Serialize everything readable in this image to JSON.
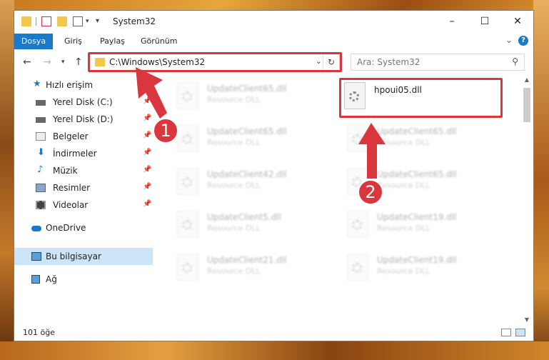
{
  "window": {
    "title": "System32"
  },
  "ribbon": {
    "tabs": [
      "Dosya",
      "Giriş",
      "Paylaş",
      "Görünüm"
    ]
  },
  "address": {
    "path": "C:\\Windows\\System32"
  },
  "search": {
    "placeholder": "Ara: System32"
  },
  "sidebar": {
    "items": [
      {
        "label": "Hızlı erişim",
        "icon": "star-icon"
      },
      {
        "label": "Yerel Disk (C:)",
        "icon": "drive-icon",
        "pinned": true
      },
      {
        "label": "Yerel Disk (D:)",
        "icon": "drive-icon",
        "pinned": true
      },
      {
        "label": "Belgeler",
        "icon": "documents-icon",
        "pinned": true
      },
      {
        "label": "İndirmeler",
        "icon": "download-icon",
        "pinned": true
      },
      {
        "label": "Müzik",
        "icon": "music-icon",
        "pinned": true
      },
      {
        "label": "Resimler",
        "icon": "pictures-icon",
        "pinned": true
      },
      {
        "label": "Videolar",
        "icon": "videos-icon",
        "pinned": true
      },
      {
        "label": "OneDrive",
        "icon": "cloud-icon"
      },
      {
        "label": "Bu bilgisayar",
        "icon": "computer-icon",
        "selected": true
      },
      {
        "label": "Ağ",
        "icon": "network-icon"
      }
    ]
  },
  "files": {
    "highlighted": {
      "name": "hpoui05.dll"
    },
    "items": [
      {
        "name": "UpdateClient65.dll",
        "type": "Resource DLL"
      },
      {
        "name": "UpdateClient65.dll",
        "type": "Resource DLL"
      },
      {
        "name": "UpdateClient65.dll",
        "type": "Resource DLL"
      },
      {
        "name": "UpdateClient42.dll",
        "type": "Resource DLL"
      },
      {
        "name": "UpdateClient65.dll",
        "type": "Resource DLL"
      },
      {
        "name": "UpdateClient5.dll",
        "type": "Resource DLL"
      },
      {
        "name": "UpdateClient19.dll",
        "type": "Resource DLL"
      },
      {
        "name": "UpdateClient21.dll",
        "type": "Resource DLL"
      },
      {
        "name": "UpdateClient19.dll",
        "type": "Resource DLL"
      }
    ]
  },
  "status": {
    "count": "101 öğe"
  },
  "annotations": {
    "badge1": "1",
    "badge2": "2"
  },
  "colors": {
    "accent": "#1979ca",
    "highlight": "#d9363e",
    "selection": "#cce4f7"
  }
}
